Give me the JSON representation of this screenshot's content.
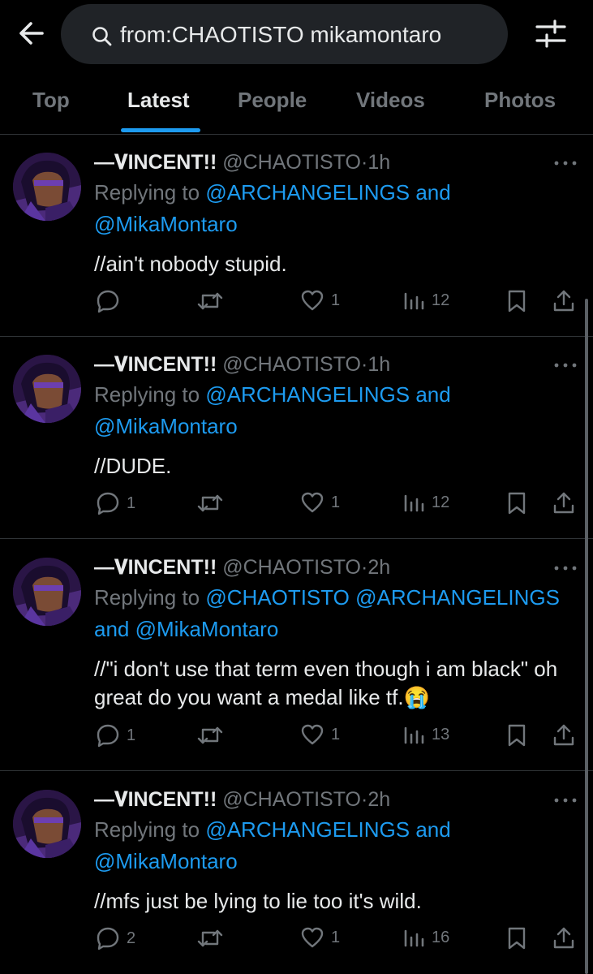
{
  "search": {
    "query": "from:CHAOTISTO mikamontaro",
    "icon": "search-icon"
  },
  "header": {
    "back_icon": "back-arrow-icon",
    "filter_icon": "filter-sliders-icon"
  },
  "tabs": [
    {
      "label": "Top"
    },
    {
      "label": "Latest",
      "active": true
    },
    {
      "label": "People"
    },
    {
      "label": "Videos"
    },
    {
      "label": "Photos"
    }
  ],
  "colors": {
    "background": "#000000",
    "accent": "#1d9bf0",
    "muted": "#71767b",
    "text": "#e7e9ea"
  },
  "tweets": [
    {
      "name": "—𝐕INCENT!!",
      "handle": "@CHAOTISTO",
      "dot": "·",
      "time": "1h",
      "replying_prefix": "Replying to",
      "mentions": [
        "@ARCHANGELINGS",
        "and",
        "@MikaMontaro"
      ],
      "text": "//ain't nobody stupid.",
      "stats": {
        "replies": "",
        "reposts": "",
        "likes": "1",
        "views": "12"
      }
    },
    {
      "name": "—𝐕INCENT!!",
      "handle": "@CHAOTISTO",
      "dot": "·",
      "time": "1h",
      "replying_prefix": "Replying to",
      "mentions": [
        "@ARCHANGELINGS",
        "and",
        "@MikaMontaro"
      ],
      "text": "//DUDE.",
      "stats": {
        "replies": "1",
        "reposts": "",
        "likes": "1",
        "views": "12"
      }
    },
    {
      "name": "—𝐕INCENT!!",
      "handle": "@CHAOTISTO",
      "dot": "·",
      "time": "2h",
      "replying_prefix": "Replying to",
      "mentions": [
        "@CHAOTISTO",
        "@ARCHANGELINGS",
        "and",
        "@MikaMontaro"
      ],
      "text": "//\"i don't use that term even though i am black\" oh great do you want a medal like tf.😭",
      "stats": {
        "replies": "1",
        "reposts": "",
        "likes": "1",
        "views": "13"
      }
    },
    {
      "name": "—𝐕INCENT!!",
      "handle": "@CHAOTISTO",
      "dot": "·",
      "time": "2h",
      "replying_prefix": "Replying to",
      "mentions": [
        "@ARCHANGELINGS",
        "and",
        "@MikaMontaro"
      ],
      "text": "//mfs just be lying to lie too it's wild.",
      "stats": {
        "replies": "2",
        "reposts": "",
        "likes": "1",
        "views": "16"
      }
    }
  ]
}
